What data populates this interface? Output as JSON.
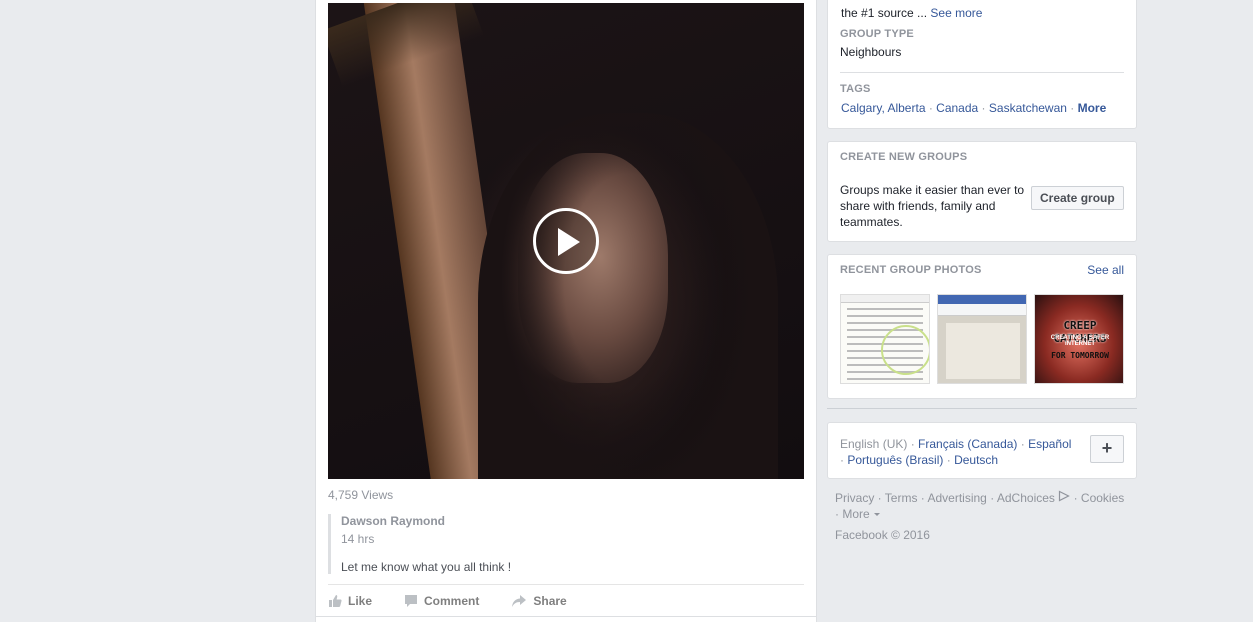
{
  "post": {
    "views": "4,759 Views",
    "author": "Dawson Raymond",
    "time": "14 hrs",
    "message": "Let me know what you all think !",
    "actions": {
      "like": "Like",
      "comment": "Comment",
      "share": "Share"
    }
  },
  "about": {
    "description": "the #1 source ...",
    "see_more": "See more",
    "group_type_label": "GROUP TYPE",
    "group_type_value": "Neighbours",
    "tags_label": "TAGS",
    "tags": [
      "Calgary, Alberta",
      "Canada",
      "Saskatchewan"
    ],
    "tags_more": "More"
  },
  "create_groups": {
    "title": "CREATE NEW GROUPS",
    "text": "Groups make it easier than ever to share with friends, family and teammates.",
    "button": "Create group"
  },
  "photos": {
    "title": "RECENT GROUP PHOTOS",
    "see_all": "See all",
    "thumb3_title": "CREEP CATCHERS",
    "thumb3_subtitle": "CREATING A SAFER INTERNET",
    "thumb3_bottom": "FOR TOMORROW"
  },
  "languages": {
    "current": "English (UK)",
    "others": [
      "Français (Canada)",
      "Español",
      "Português (Brasil)",
      "Deutsch"
    ],
    "plus": "+"
  },
  "footer": {
    "links": [
      "Privacy",
      "Terms",
      "Advertising",
      "AdChoices",
      "Cookies"
    ],
    "more": "More",
    "copyright": "Facebook © 2016"
  }
}
